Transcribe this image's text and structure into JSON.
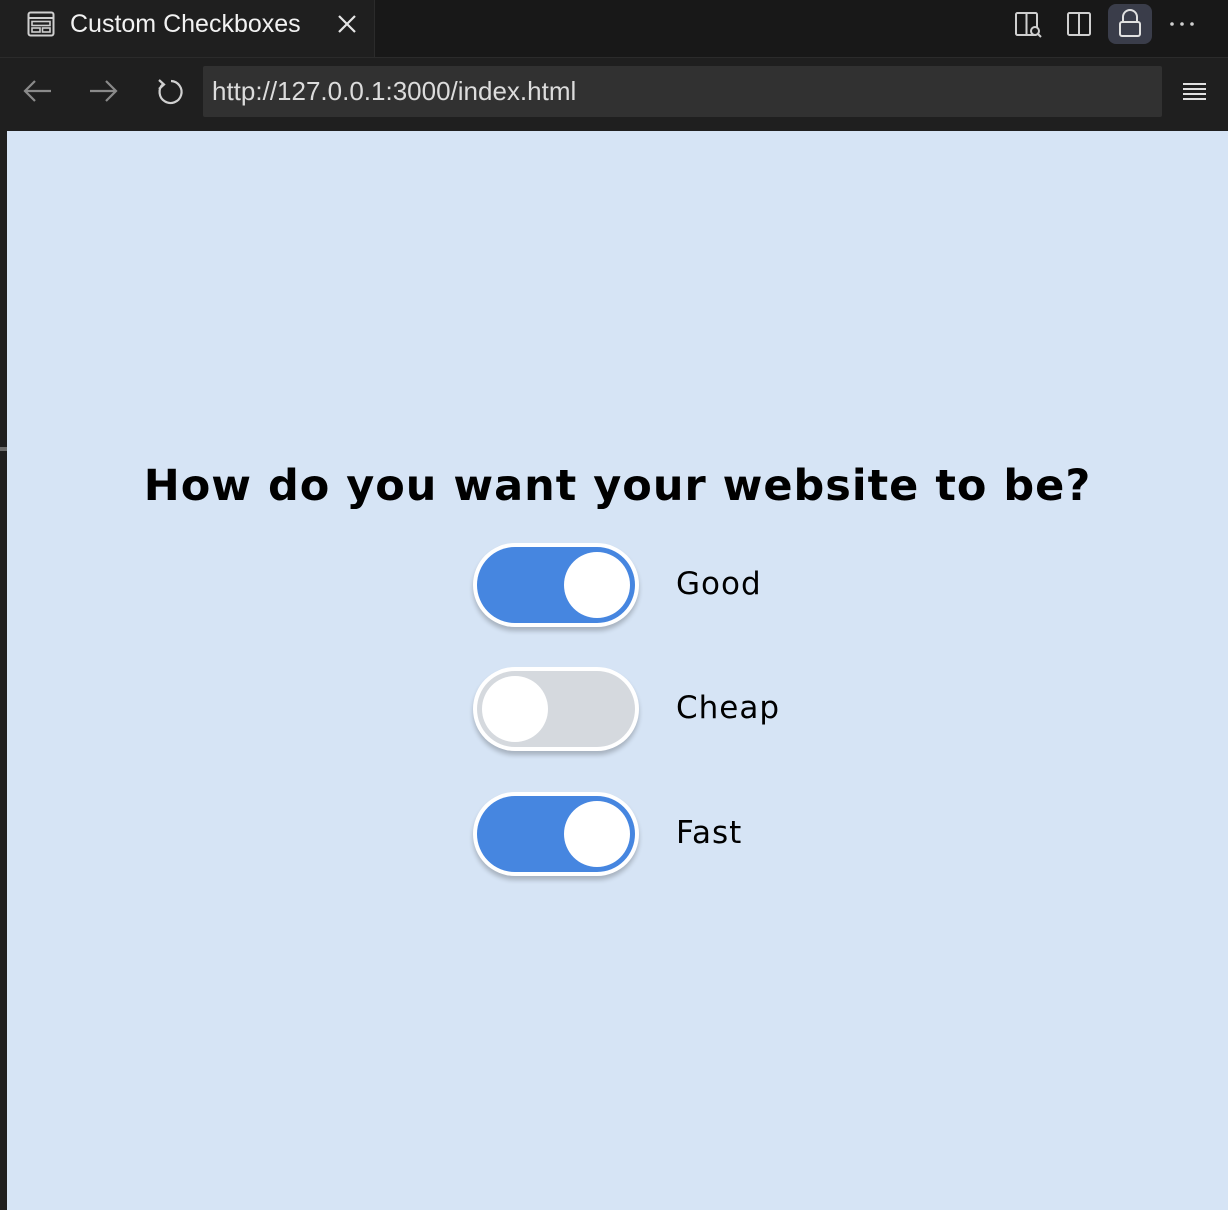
{
  "tab": {
    "title": "Custom Checkboxes",
    "icon": "browser-preview-icon",
    "close_icon": "close-icon"
  },
  "toolbar": {
    "icons": [
      "open-in-editor-icon",
      "split-editor-icon",
      "lock-icon",
      "more-actions-icon"
    ]
  },
  "nav": {
    "back_icon": "arrow-left-icon",
    "forward_icon": "arrow-right-icon",
    "reload_icon": "reload-icon",
    "url": "http://127.0.0.1:3000/index.html",
    "menu_icon": "hamburger-menu-icon"
  },
  "page": {
    "background": "#d6e4f5",
    "heading": "How do you want your website to be?",
    "accent_color": "#4686e0",
    "off_color": "#d5d9de",
    "options": [
      {
        "label": "Good",
        "checked": true
      },
      {
        "label": "Cheap",
        "checked": false
      },
      {
        "label": "Fast",
        "checked": true
      }
    ]
  }
}
